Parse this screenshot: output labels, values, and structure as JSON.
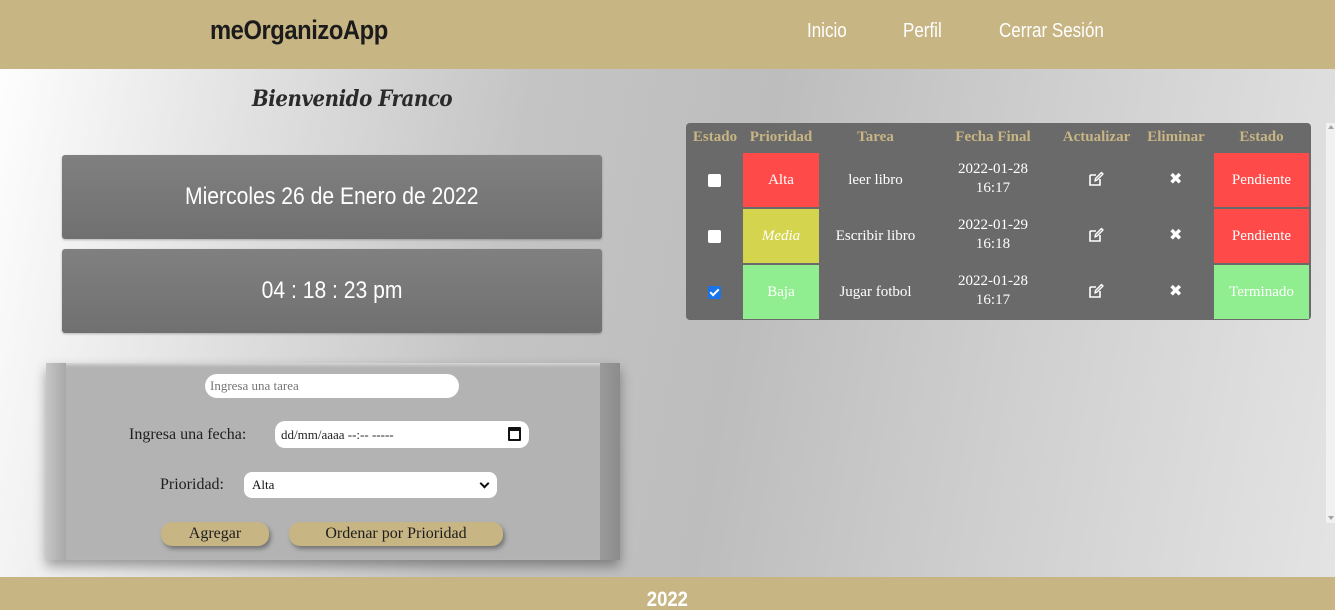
{
  "navbar": {
    "brand": "meOrganizoApp",
    "links": [
      "Inicio",
      "Perfil",
      "Cerrar Sesión"
    ]
  },
  "welcome": "Bienvenido Franco",
  "date_display": "Miercoles 26 de Enero de 2022",
  "clock_display": "04 : 18 : 23 pm",
  "form": {
    "task_placeholder": "Ingresa una tarea",
    "date_label": "Ingresa una fecha:",
    "date_value": "dd/mm/aaaa --:-- -----",
    "priority_label": "Prioridad:",
    "priority_selected": "Alta",
    "add_button": "Agregar",
    "sort_button": "Ordenar por Prioridad"
  },
  "table": {
    "headers": [
      "Estado",
      "Prioridad",
      "Tarea",
      "Fecha Final",
      "Actualizar",
      "Eliminar",
      "Estado"
    ],
    "rows": [
      {
        "checked": false,
        "priority": "Alta",
        "priority_color": "#ff4a4a",
        "task": "leer libro",
        "date": "2022-01-28",
        "time": "16:17",
        "status": "Pendiente",
        "status_color": "#ff4a4a"
      },
      {
        "checked": false,
        "priority": "Media",
        "priority_color": "#d4d44e",
        "task": "Escribir libro",
        "date": "2022-01-29",
        "time": "16:18",
        "status": "Pendiente",
        "status_color": "#ff4a4a"
      },
      {
        "checked": true,
        "priority": "Baja",
        "priority_color": "#90ee90",
        "task": "Jugar fotbol",
        "date": "2022-01-28",
        "time": "16:17",
        "status": "Terminado",
        "status_color": "#90ee90"
      }
    ]
  },
  "icons": {
    "edit": "edit-icon",
    "delete": "close-icon"
  },
  "colors": {
    "accent": "#c8b584",
    "table_bg": "#6a6a6a",
    "info_box": "#777777"
  },
  "footer": "2022"
}
